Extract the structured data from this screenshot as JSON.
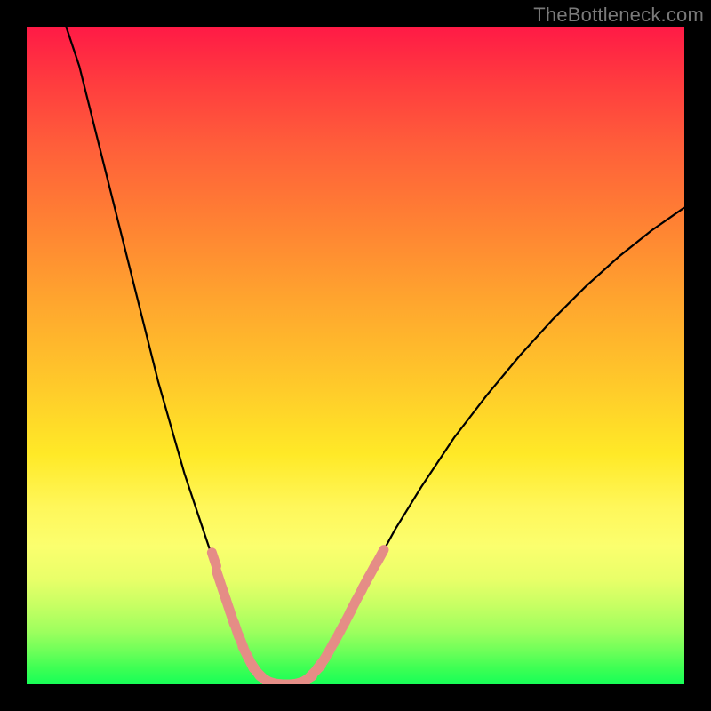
{
  "watermark": "TheBottleneck.com",
  "colors": {
    "background_outer": "#000000",
    "gradient_top": "#ff1a46",
    "gradient_bottom": "#17ff57",
    "curve_stroke": "#000000",
    "marker_fill": "#e58d86"
  },
  "chart_data": {
    "type": "line",
    "title": "",
    "xlabel": "",
    "ylabel": "",
    "xlim": [
      0,
      100
    ],
    "ylim": [
      0,
      100
    ],
    "grid": false,
    "legend": false,
    "curve_points": [
      {
        "x": 6,
        "y": 100
      },
      {
        "x": 8,
        "y": 94
      },
      {
        "x": 10,
        "y": 86
      },
      {
        "x": 12,
        "y": 78
      },
      {
        "x": 14,
        "y": 70
      },
      {
        "x": 16,
        "y": 62
      },
      {
        "x": 18,
        "y": 54
      },
      {
        "x": 20,
        "y": 46
      },
      {
        "x": 22,
        "y": 39
      },
      {
        "x": 24,
        "y": 32
      },
      {
        "x": 26,
        "y": 26
      },
      {
        "x": 28,
        "y": 20
      },
      {
        "x": 29,
        "y": 17
      },
      {
        "x": 30,
        "y": 14
      },
      {
        "x": 31,
        "y": 11
      },
      {
        "x": 32,
        "y": 8
      },
      {
        "x": 33,
        "y": 5.5
      },
      {
        "x": 34,
        "y": 3.5
      },
      {
        "x": 35,
        "y": 2
      },
      {
        "x": 36,
        "y": 1
      },
      {
        "x": 37,
        "y": 0.4
      },
      {
        "x": 38,
        "y": 0.1
      },
      {
        "x": 39,
        "y": 0
      },
      {
        "x": 40,
        "y": 0
      },
      {
        "x": 41,
        "y": 0.1
      },
      {
        "x": 42,
        "y": 0.4
      },
      {
        "x": 43,
        "y": 1
      },
      {
        "x": 44,
        "y": 2
      },
      {
        "x": 45,
        "y": 3.3
      },
      {
        "x": 46,
        "y": 5
      },
      {
        "x": 48,
        "y": 8.7
      },
      {
        "x": 50,
        "y": 12.5
      },
      {
        "x": 53,
        "y": 18
      },
      {
        "x": 56,
        "y": 23.5
      },
      {
        "x": 60,
        "y": 30
      },
      {
        "x": 65,
        "y": 37.5
      },
      {
        "x": 70,
        "y": 44
      },
      {
        "x": 75,
        "y": 50
      },
      {
        "x": 80,
        "y": 55.5
      },
      {
        "x": 85,
        "y": 60.5
      },
      {
        "x": 90,
        "y": 65
      },
      {
        "x": 95,
        "y": 69
      },
      {
        "x": 100,
        "y": 72.5
      }
    ],
    "markers": [
      {
        "x": 28.5,
        "y": 19
      },
      {
        "x": 29.2,
        "y": 16.2
      },
      {
        "x": 30.0,
        "y": 13.8
      },
      {
        "x": 30.6,
        "y": 12.0
      },
      {
        "x": 31.2,
        "y": 10.2
      },
      {
        "x": 31.9,
        "y": 8.3
      },
      {
        "x": 32.6,
        "y": 6.5
      },
      {
        "x": 33.3,
        "y": 4.8
      },
      {
        "x": 34.0,
        "y": 3.4
      },
      {
        "x": 34.8,
        "y": 2.2
      },
      {
        "x": 35.6,
        "y": 1.3
      },
      {
        "x": 36.5,
        "y": 0.6
      },
      {
        "x": 37.5,
        "y": 0.2
      },
      {
        "x": 38.5,
        "y": 0.05
      },
      {
        "x": 39.5,
        "y": 0.0
      },
      {
        "x": 40.5,
        "y": 0.05
      },
      {
        "x": 41.5,
        "y": 0.25
      },
      {
        "x": 42.5,
        "y": 0.7
      },
      {
        "x": 43.3,
        "y": 1.4
      },
      {
        "x": 44.0,
        "y": 2.1
      },
      {
        "x": 44.8,
        "y": 3.2
      },
      {
        "x": 45.6,
        "y": 4.4
      },
      {
        "x": 46.4,
        "y": 5.8
      },
      {
        "x": 47.2,
        "y": 7.2
      },
      {
        "x": 48.0,
        "y": 8.7
      },
      {
        "x": 48.8,
        "y": 10.2
      },
      {
        "x": 49.6,
        "y": 11.8
      },
      {
        "x": 50.5,
        "y": 13.5
      },
      {
        "x": 51.5,
        "y": 15.4
      },
      {
        "x": 52.6,
        "y": 17.4
      },
      {
        "x": 53.8,
        "y": 19.5
      }
    ]
  }
}
